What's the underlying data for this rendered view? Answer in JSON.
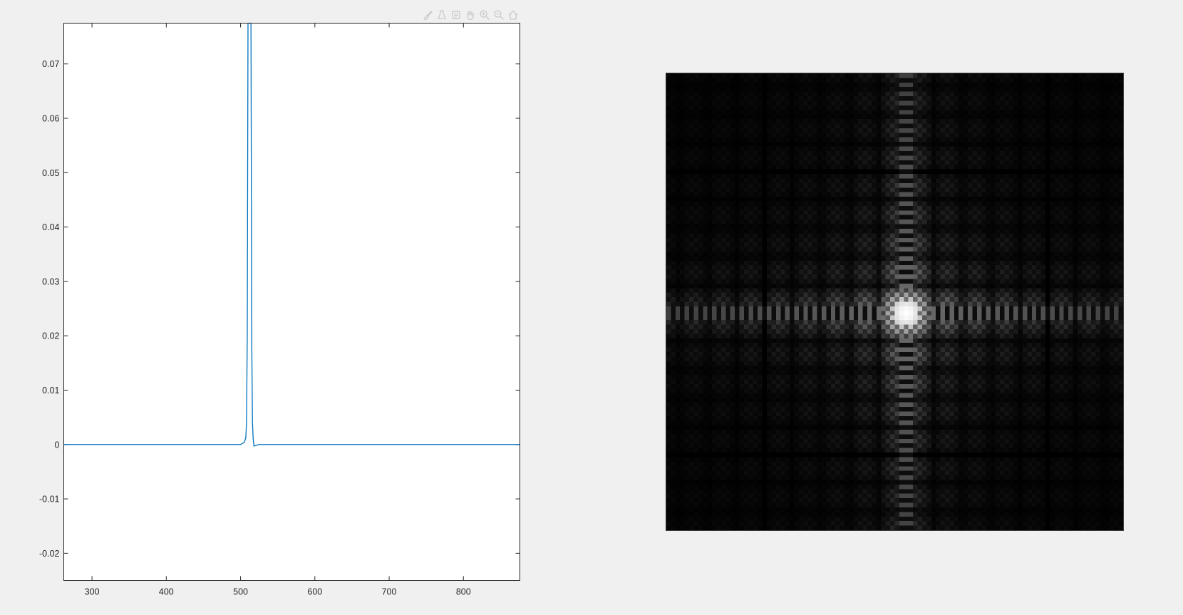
{
  "toolbar": {
    "items": [
      {
        "name": "brush-icon"
      },
      {
        "name": "data-tips-icon"
      },
      {
        "name": "datatip-card-icon"
      },
      {
        "name": "pan-hand-icon"
      },
      {
        "name": "zoom-in-icon"
      },
      {
        "name": "zoom-out-icon"
      },
      {
        "name": "home-icon"
      }
    ]
  },
  "colors": {
    "line": "#0072BD",
    "axes_bg": "#ffffff",
    "figure_bg": "#f0f0f0",
    "axis_stroke": "#262626"
  },
  "chart_data": [
    {
      "type": "line",
      "title": "",
      "xlabel": "",
      "ylabel": "",
      "xlim": [
        262,
        876
      ],
      "ylim": [
        -0.025,
        0.0775
      ],
      "xticks": [
        300,
        400,
        500,
        600,
        700,
        800
      ],
      "xtick_labels": [
        "300",
        "400",
        "500",
        "600",
        "700",
        "800"
      ],
      "yticks": [
        -0.02,
        -0.01,
        0,
        0.01,
        0.02,
        0.03,
        0.04,
        0.05,
        0.06,
        0.07
      ],
      "ytick_labels": [
        "-0.02",
        "-0.01",
        "0",
        "0.01",
        "0.02",
        "0.03",
        "0.04",
        "0.05",
        "0.06",
        "0.07"
      ],
      "grid": false,
      "series": [
        {
          "x": [
            262,
            480,
            500,
            505,
            507,
            508,
            509,
            510,
            511,
            512,
            513,
            514,
            515,
            516,
            517,
            518,
            520,
            525,
            545,
            876
          ],
          "values": [
            0,
            0,
            0,
            0.0004,
            0.0012,
            0.004,
            0.02,
            0.09,
            0.09,
            0.09,
            0.09,
            0.09,
            0.02,
            0.004,
            0.001,
            -0.0003,
            -0.0002,
            0,
            0,
            0
          ]
        }
      ]
    },
    {
      "type": "heatmap",
      "title": "",
      "colormap": "gray",
      "grid_size": 100,
      "center": [
        52,
        52
      ],
      "pattern": "2D Fourier magnitude spectrum of a square aperture: bright central disk with cross-shaped striped arms along horizontal and vertical center lines"
    }
  ]
}
